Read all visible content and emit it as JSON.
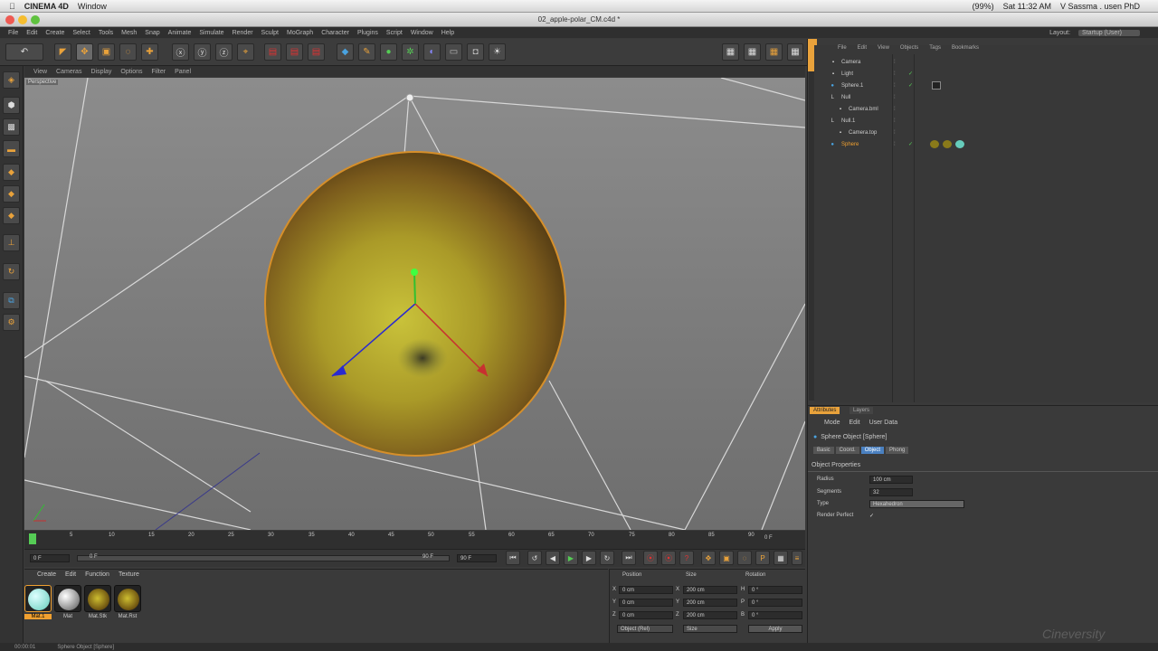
{
  "mac_menubar": {
    "app": "CINEMA 4D",
    "window_menu": "Window",
    "clock": "Sat 11:32 AM",
    "user": "V Sassma . usen PhD",
    "battery": "(99%)"
  },
  "window": {
    "title": "02_apple-polar_CM.c4d *"
  },
  "main_menu": [
    "File",
    "Edit",
    "Create",
    "Select",
    "Tools",
    "Mesh",
    "Snap",
    "Animate",
    "Simulate",
    "Render",
    "Sculpt",
    "MoGraph",
    "Character",
    "Plugins",
    "Script",
    "Window",
    "Help"
  ],
  "layout": {
    "label": "Layout:",
    "value": "Startup (User)"
  },
  "viewport": {
    "menu": [
      "View",
      "Cameras",
      "Display",
      "Options",
      "Filter",
      "Panel"
    ],
    "name": "Perspective"
  },
  "timeline": {
    "ticks": [
      "0",
      "5",
      "10",
      "15",
      "20",
      "25",
      "30",
      "35",
      "40",
      "45",
      "50",
      "55",
      "60",
      "65",
      "70",
      "75",
      "80",
      "85",
      "90"
    ],
    "frame_readout": "0 F"
  },
  "transport": {
    "start": "0 F",
    "mid": "0 F",
    "end_a": "90 F",
    "end_b": "90 F"
  },
  "materials": {
    "menu": [
      "Create",
      "Edit",
      "Function",
      "Texture"
    ],
    "items": [
      {
        "label": "Mat.1"
      },
      {
        "label": "Mat"
      },
      {
        "label": "Mat.Stk"
      },
      {
        "label": "Mat.Rst"
      }
    ]
  },
  "coords": {
    "headers": [
      "Position",
      "Size",
      "Rotation"
    ],
    "rows": [
      {
        "axis": "X",
        "pos": "0 cm",
        "saxis": "X",
        "size": "200 cm",
        "raxis": "H",
        "rot": "0 °"
      },
      {
        "axis": "Y",
        "pos": "0 cm",
        "saxis": "Y",
        "size": "200 cm",
        "raxis": "P",
        "rot": "0 °"
      },
      {
        "axis": "Z",
        "pos": "0 cm",
        "saxis": "Z",
        "size": "200 cm",
        "raxis": "B",
        "rot": "0 °"
      }
    ],
    "mode_a": "Object (Rel)",
    "mode_b": "Size",
    "apply": "Apply"
  },
  "object_manager": {
    "menu": [
      "File",
      "Edit",
      "View",
      "Objects",
      "Tags",
      "Bookmarks"
    ],
    "objects": [
      {
        "name": "Camera",
        "indent": 0
      },
      {
        "name": "Light",
        "indent": 0
      },
      {
        "name": "Sphere.1",
        "indent": 0
      },
      {
        "name": "Null",
        "indent": 0
      },
      {
        "name": "Camera.bml",
        "indent": 1
      },
      {
        "name": "Null.1",
        "indent": 0
      },
      {
        "name": "Camera.top",
        "indent": 1
      },
      {
        "name": "Sphere",
        "indent": 0
      }
    ]
  },
  "attributes": {
    "tabs": [
      "Attributes",
      "Layers"
    ],
    "menu": [
      "Mode",
      "Edit",
      "User Data"
    ],
    "object_title": "Sphere Object [Sphere]",
    "subtabs": [
      "Basic",
      "Coord.",
      "Object",
      "Phong"
    ],
    "section": "Object Properties",
    "props": [
      {
        "label": "Radius",
        "value": "100 cm"
      },
      {
        "label": "Segments",
        "value": "32"
      },
      {
        "label": "Type",
        "value": "Hexahedron"
      },
      {
        "label": "Render Perfect",
        "value": "✓"
      }
    ]
  },
  "status": {
    "time": "00:00:01",
    "message": "Sphere Object [Sphere]"
  },
  "watermark": "Cineversity",
  "colors": {
    "accent": "#e9a23b",
    "selected": "#f0a030",
    "viewport_bg": "#858585"
  }
}
